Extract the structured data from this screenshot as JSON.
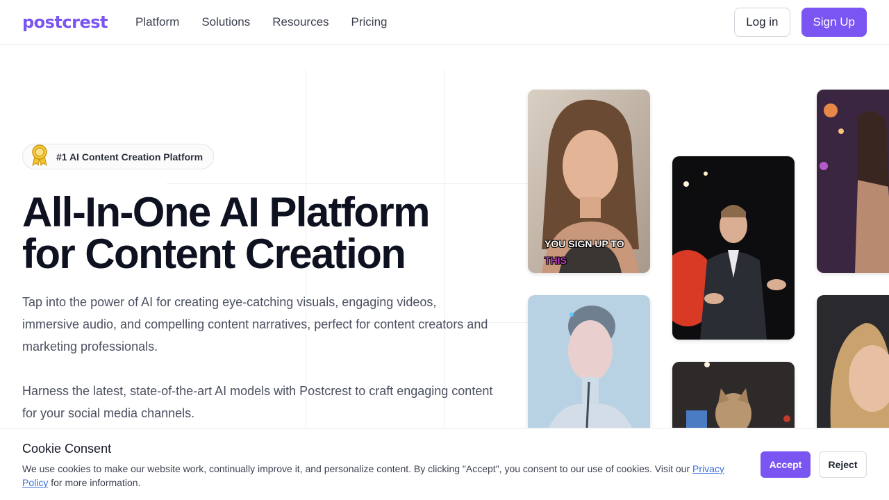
{
  "header": {
    "logo": "postcrest",
    "nav": [
      "Platform",
      "Solutions",
      "Resources",
      "Pricing"
    ],
    "login_label": "Log in",
    "signup_label": "Sign Up"
  },
  "hero": {
    "badge": "#1 AI Content Creation Platform",
    "title_line1": "All-In-One AI Platform",
    "title_line2": "for Content Creation",
    "paragraph1": "Tap into the power of AI for creating eye-catching visuals, engaging videos, immersive audio, and compelling content narratives, perfect for content creators and marketing professionals.",
    "paragraph2": "Harness the latest, state-of-the-art AI models with Postcrest to craft engaging content for your social media channels."
  },
  "gallery": {
    "caption_line1": "YOU SIGN UP TO",
    "caption_line2": "THIS"
  },
  "cookie": {
    "title": "Cookie Consent",
    "text": "We use cookies to make our website work, continually improve it, and personalize content. By clicking \"Accept\", you consent to our use of cookies. Visit our ",
    "link": "Privacy Policy",
    "text_end": " for more information.",
    "accept_label": "Accept",
    "reject_label": "Reject"
  },
  "colors": {
    "brand": "#7b55f2",
    "heading": "#0e1220",
    "body_text": "#4b5060",
    "link": "#3b6fd9"
  }
}
